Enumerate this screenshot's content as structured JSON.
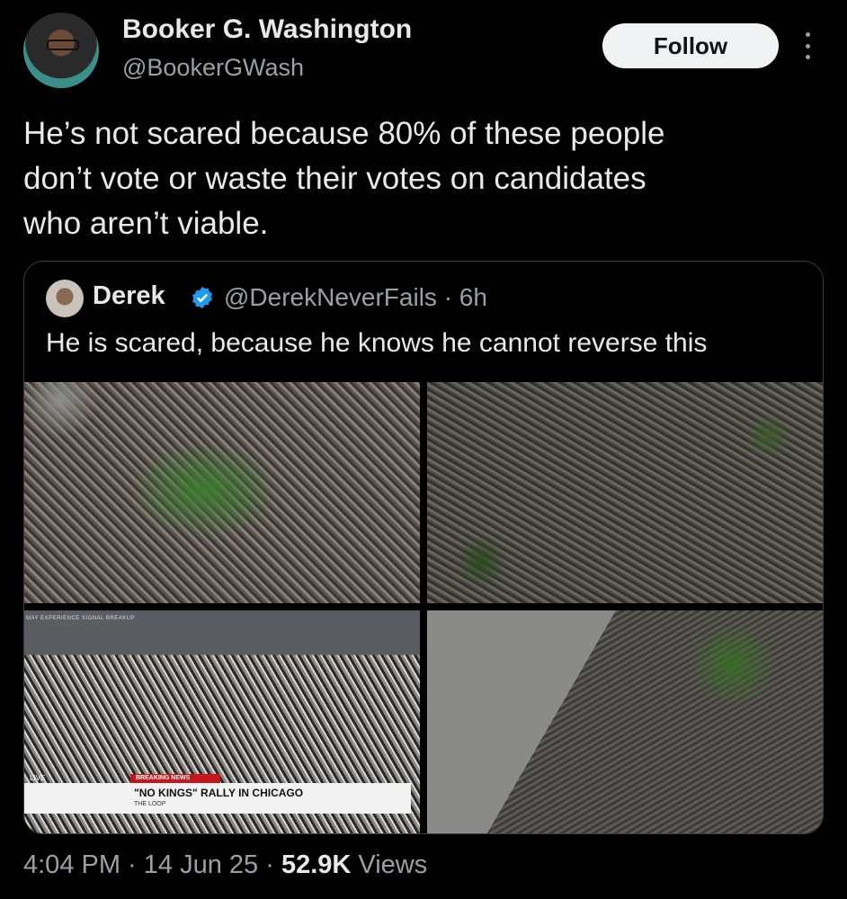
{
  "author": {
    "name": "Booker G. Washington",
    "handle": "@BookerGWash"
  },
  "follow_label": "Follow",
  "tweet_text": "He’s not scared because 80% of these people\ndon’t vote or waste their votes on candidates\nwho aren’t viable.",
  "quoted": {
    "name": "Derek",
    "meta": "@DerekNeverFails · 6h",
    "text": "He is scared, because he knows he cannot reverse this",
    "broadcast": {
      "top_label": "MAY EXPERIENCE SIGNAL BREAKUP",
      "live": "LIVE",
      "breaking": "BREAKING NEWS",
      "headline": "\"NO KINGS\" RALLY IN CHICAGO",
      "sub": "THE LOOP"
    }
  },
  "footer": {
    "time": "4:04 PM · 14 Jun 25 · ",
    "views_count": "52.9K",
    "views_label": " Views"
  },
  "colors": {
    "background": "#000000",
    "text": "#e7e9ea",
    "muted": "#9aa0a6",
    "verified": "#1d9bf0"
  }
}
